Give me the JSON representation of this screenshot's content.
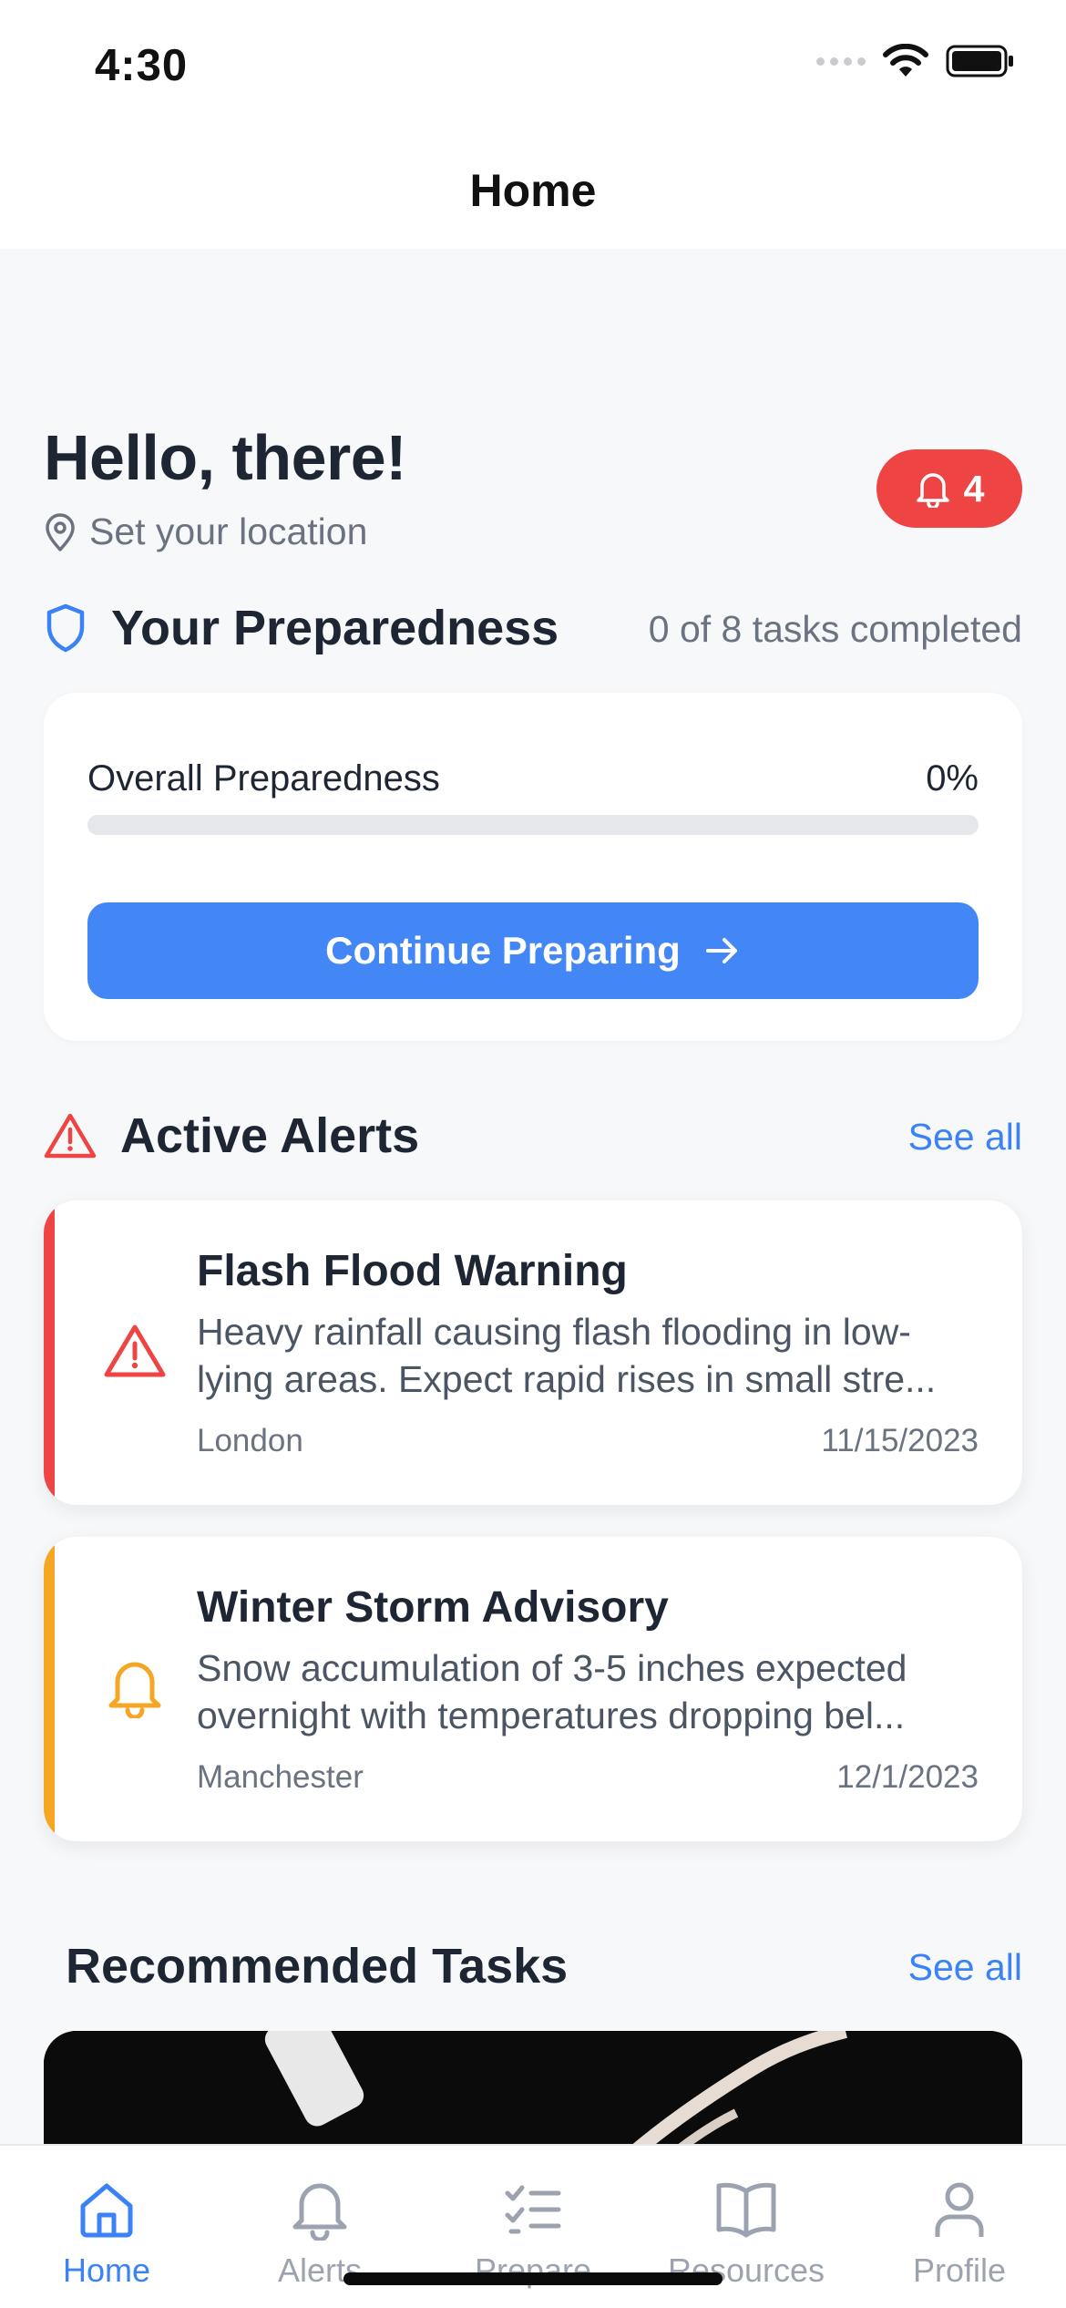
{
  "status_bar": {
    "time": "4:30"
  },
  "header": {
    "title": "Home"
  },
  "greeting": {
    "title": "Hello, there!",
    "location_prompt": "Set your location"
  },
  "alert_badge": {
    "count": "4"
  },
  "preparedness": {
    "section_title": "Your Preparedness",
    "summary": "0 of 8 tasks completed",
    "overall_label": "Overall Preparedness",
    "percent_text": "0%",
    "progress_fraction": 0,
    "cta_label": "Continue Preparing"
  },
  "active_alerts": {
    "section_title": "Active Alerts",
    "see_all": "See all",
    "items": [
      {
        "title": "Flash Flood Warning",
        "description": "Heavy rainfall causing flash flooding in low-lying areas. Expect rapid rises in small stre...",
        "location": "London",
        "date": "11/15/2023",
        "accent_color": "#ef4444",
        "icon": "warning-triangle-icon"
      },
      {
        "title": "Winter Storm Advisory",
        "description": "Snow accumulation of 3-5 inches expected overnight with temperatures dropping bel...",
        "location": "Manchester",
        "date": "12/1/2023",
        "accent_color": "#f5a623",
        "icon": "bell-icon"
      }
    ]
  },
  "recommended_tasks": {
    "section_title": "Recommended Tasks",
    "see_all": "See all"
  },
  "tab_bar": {
    "items": [
      {
        "label": "Home",
        "icon": "home-icon",
        "active": true
      },
      {
        "label": "Alerts",
        "icon": "bell-icon",
        "active": false
      },
      {
        "label": "Prepare",
        "icon": "checklist-icon",
        "active": false
      },
      {
        "label": "Resources",
        "icon": "book-icon",
        "active": false
      },
      {
        "label": "Profile",
        "icon": "person-icon",
        "active": false
      }
    ]
  },
  "colors": {
    "primary": "#3b82f6",
    "danger": "#ef4444",
    "warning": "#f5a623",
    "text": "#1f2633",
    "muted": "#6b7280",
    "background": "#f7f8fa"
  }
}
